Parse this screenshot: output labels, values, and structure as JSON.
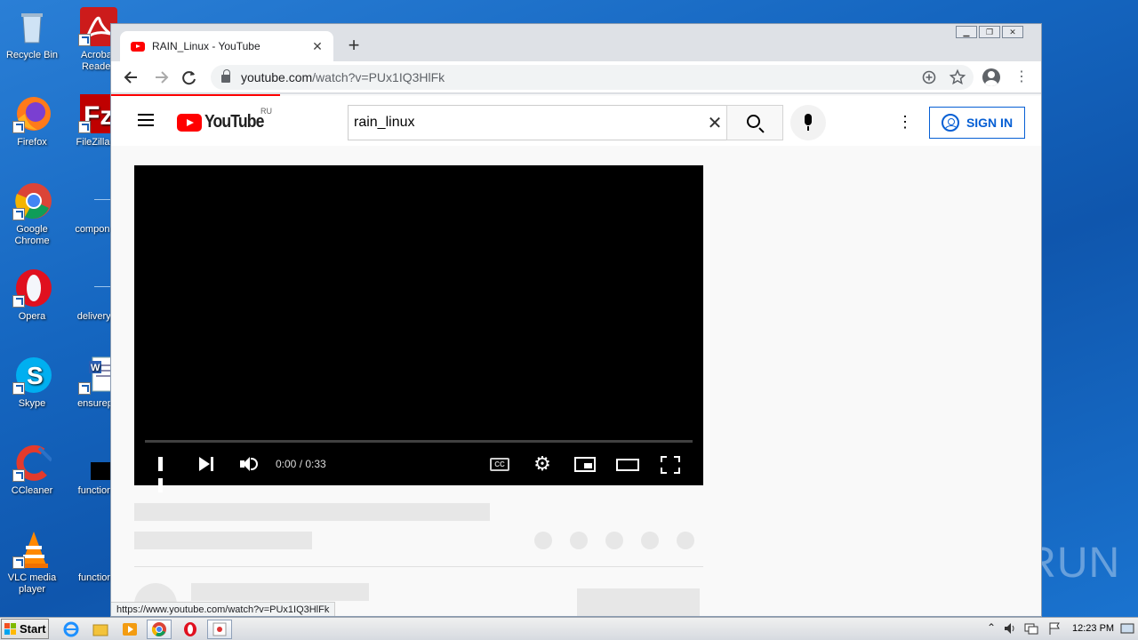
{
  "desktop": {
    "icons_col1": [
      {
        "label": "Recycle Bin",
        "icon": "recycle-bin-icon"
      },
      {
        "label": "Firefox",
        "icon": "firefox-icon"
      },
      {
        "label": "Google Chrome",
        "icon": "chrome-icon"
      },
      {
        "label": "Opera",
        "icon": "opera-icon"
      },
      {
        "label": "Skype",
        "icon": "skype-icon"
      },
      {
        "label": "CCleaner",
        "icon": "ccleaner-icon"
      },
      {
        "label": "VLC media player",
        "icon": "vlc-icon"
      }
    ],
    "icons_col2": [
      {
        "label": "Acrobat Reader",
        "icon": "acrobat-icon"
      },
      {
        "label": "FileZilla C",
        "icon": "filezilla-icon"
      },
      {
        "label": "componen",
        "icon": "file-icon"
      },
      {
        "label": "deliveryoi",
        "icon": "file-icon"
      },
      {
        "label": "ensurepa",
        "icon": "word-doc-icon"
      },
      {
        "label": "functionp",
        "icon": "file-icon"
      },
      {
        "label": "functions",
        "icon": "file-icon"
      }
    ],
    "watermark": "ANY RUN"
  },
  "browser": {
    "tab_title": "RAIN_Linux - YouTube",
    "tab_close": "✕",
    "new_tab": "+",
    "url_host": "youtube.com",
    "url_path": "/watch?v=PUx1IQ3HlFk",
    "status_url": "https://www.youtube.com/watch?v=PUx1IQ3HlFk"
  },
  "youtube": {
    "logo_text": "YouTube",
    "region": "RU",
    "search_query": "rain_linux",
    "clear": "✕",
    "sign_in": "SIGN IN",
    "player": {
      "time": "0:00 / 0:33",
      "progress": 0
    }
  },
  "taskbar": {
    "start": "Start",
    "clock": "12:23 PM"
  },
  "colors": {
    "youtube_red": "#ff0000",
    "link_blue": "#065fd4",
    "desktop_blue": "#1566c0"
  }
}
